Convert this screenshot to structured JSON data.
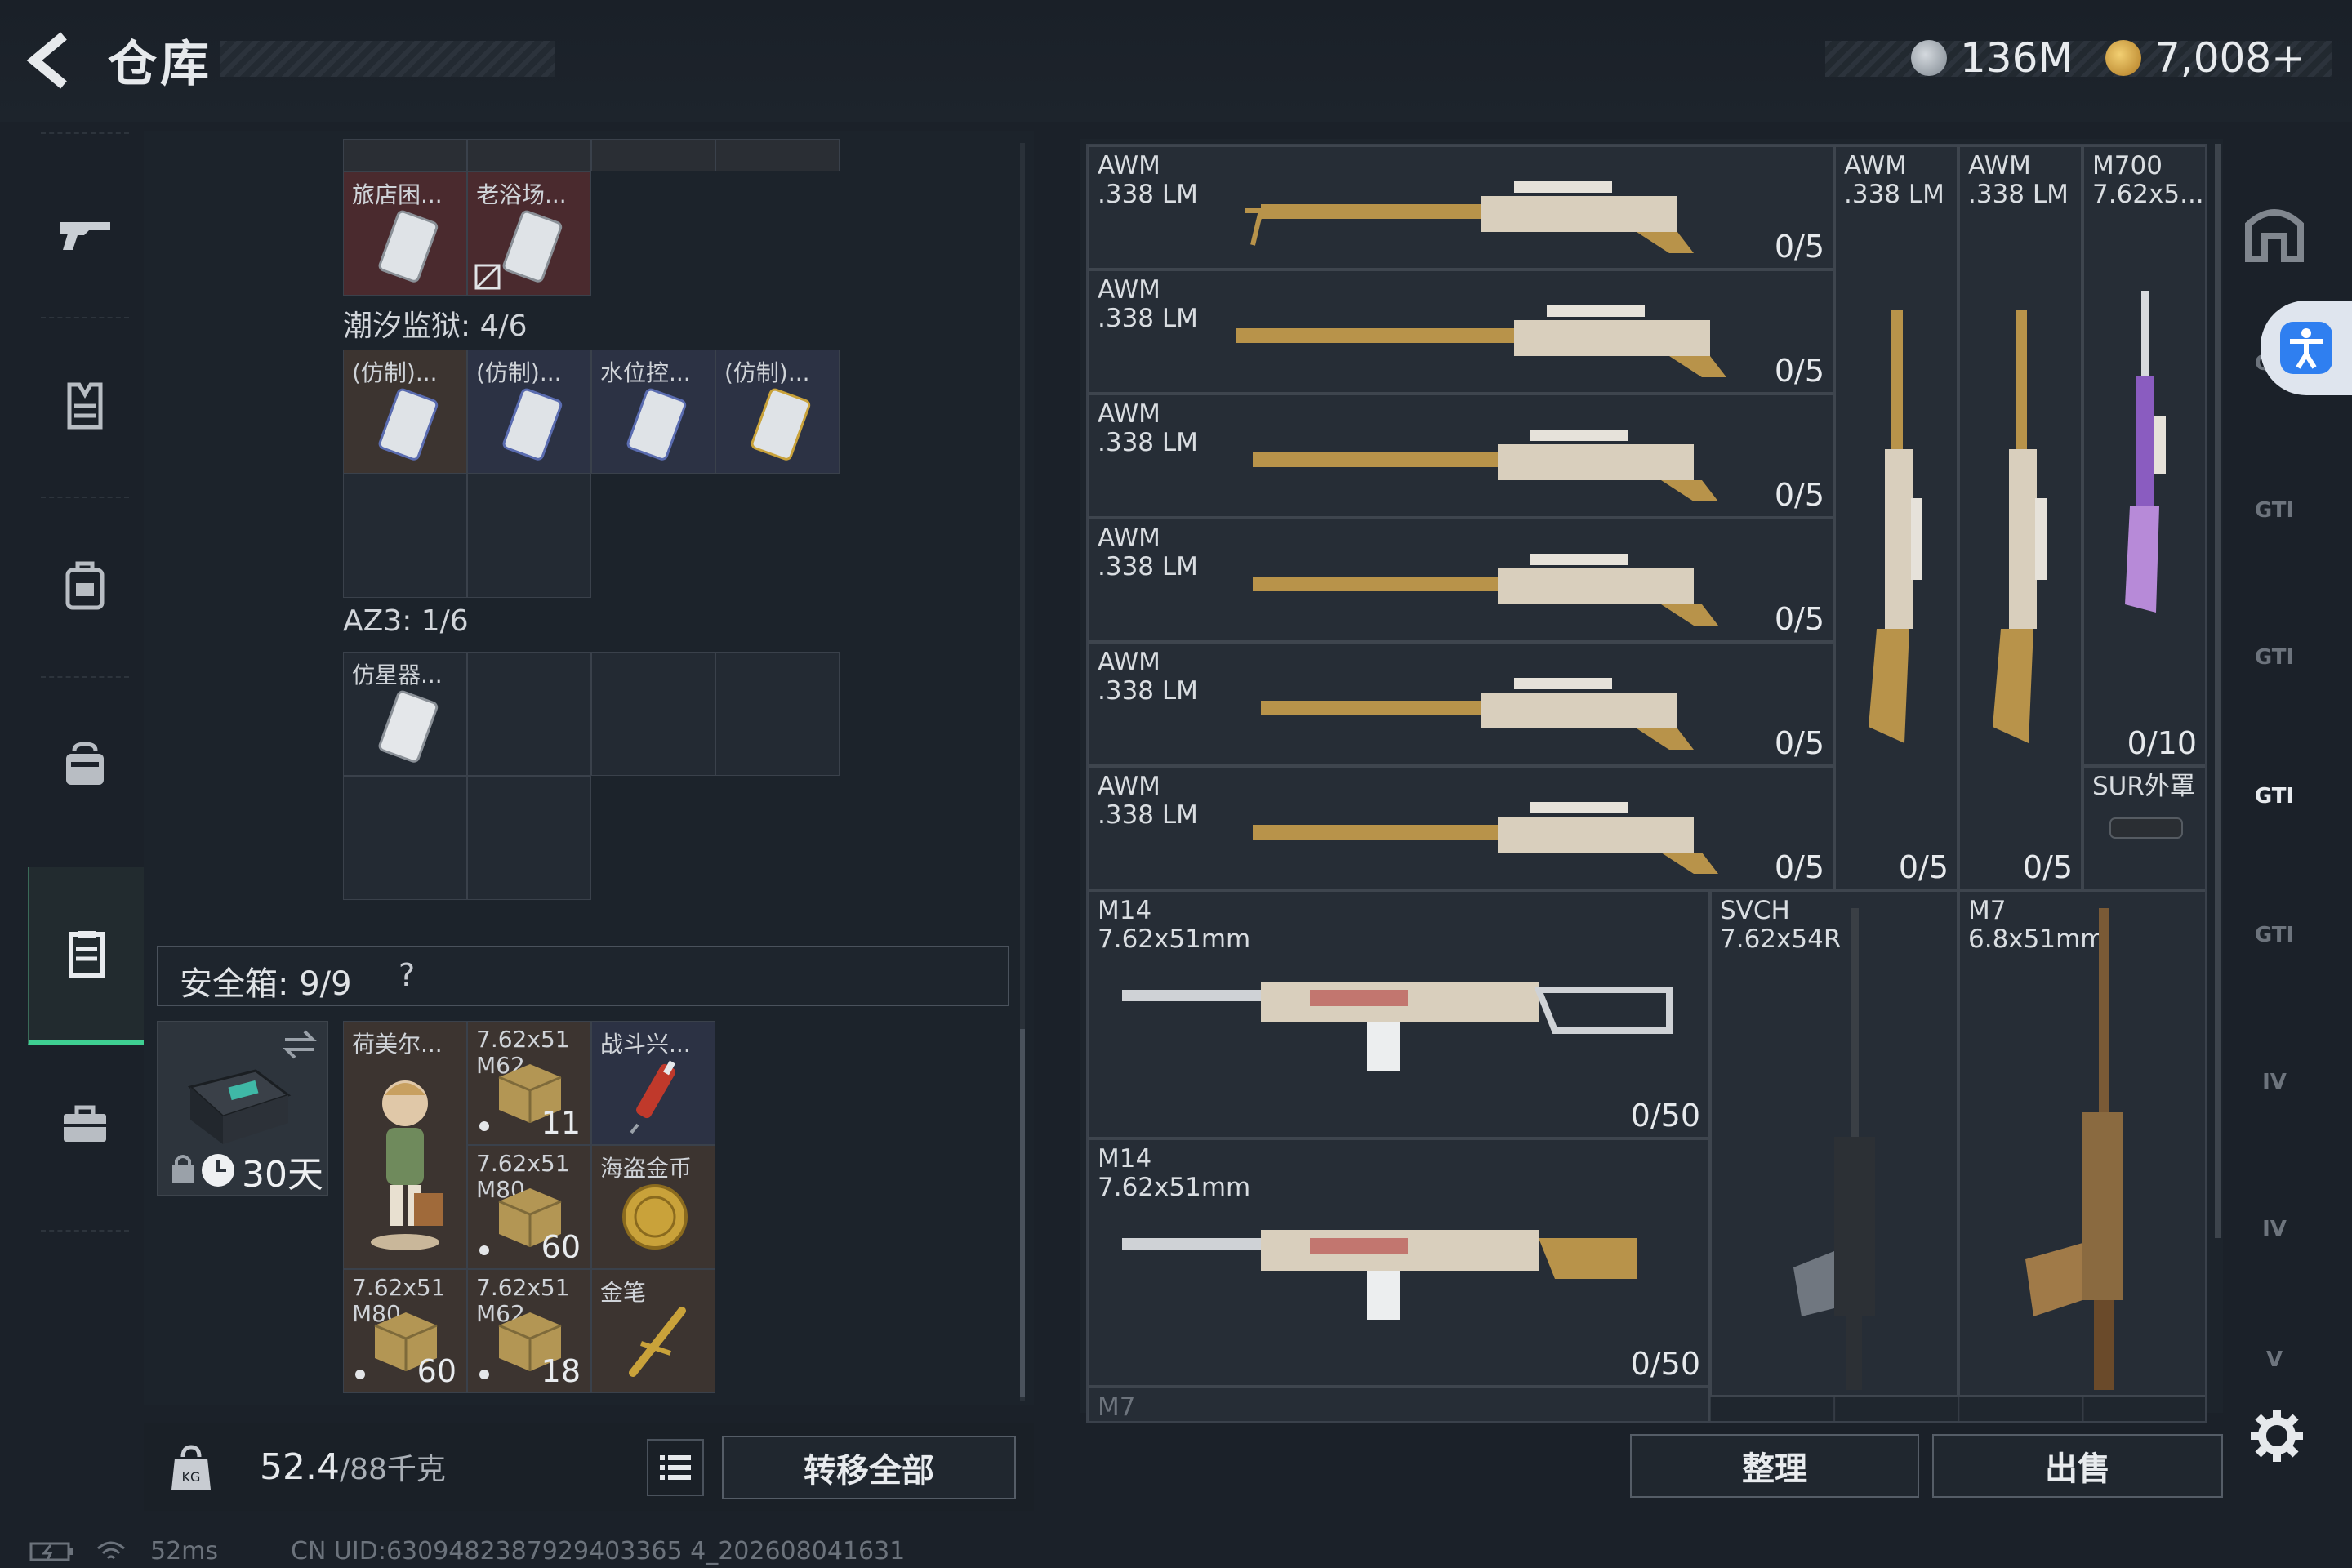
{
  "header": {
    "title": "仓库",
    "currencies": [
      {
        "icon": "silver-coin-icon",
        "value": "136M"
      },
      {
        "icon": "gold-coin-icon",
        "value": "7,008+"
      }
    ]
  },
  "nav": {
    "items": [
      {
        "icon": "weapon-icon"
      },
      {
        "icon": "armor-vest-icon"
      },
      {
        "icon": "backpack-icon"
      },
      {
        "icon": "chest-rig-icon"
      },
      {
        "icon": "container-icon",
        "active": true
      },
      {
        "icon": "briefcase-icon"
      }
    ]
  },
  "stash": {
    "top_items": [
      {
        "label": "旅店困...",
        "style": "red"
      },
      {
        "label": "老浴场...",
        "style": "red"
      }
    ],
    "sections": [
      {
        "label": "潮汐监狱: 4/6",
        "items": [
          {
            "label": "(仿制)..."
          },
          {
            "label": "(仿制)..."
          },
          {
            "label": "水位控..."
          },
          {
            "label": "(仿制)..."
          }
        ]
      },
      {
        "label": "AZ3: 1/6",
        "items": [
          {
            "label": "仿星器..."
          }
        ]
      }
    ]
  },
  "safe_box": {
    "label": "安全箱: 9/9",
    "help": "?",
    "days": "30天",
    "items": [
      {
        "label": "荷美尔...",
        "count": ""
      },
      {
        "label": "7.62x51\nM62",
        "count": "11"
      },
      {
        "label": "战斗兴...",
        "count": ""
      },
      {
        "label": "7.62x51\nM80",
        "count": "60"
      },
      {
        "label": "海盗金币",
        "count": ""
      },
      {
        "label": "7.62x51\nM80",
        "count": "60"
      },
      {
        "label": "7.62x51\nM62",
        "count": "18"
      },
      {
        "label": "金笔",
        "count": ""
      }
    ]
  },
  "footer": {
    "weight": "52.4",
    "weight_max": "/88千克",
    "transfer_all": "转移全部",
    "sort": "整理",
    "sell": "出售"
  },
  "weapons": [
    {
      "name": "AWM\n.338 LM",
      "count": "0/5"
    },
    {
      "name": "AWM\n.338 LM",
      "count": "0/5"
    },
    {
      "name": "AWM\n.338 LM",
      "count": "0/5"
    },
    {
      "name": "AWM\n.338 LM",
      "count": "0/5"
    },
    {
      "name": "AWM\n.338 LM",
      "count": "0/5"
    },
    {
      "name": "AWM\n.338 LM",
      "count": "0/5"
    },
    {
      "name": "AWM\n.338 LM",
      "count": "0/5"
    },
    {
      "name": "AWM\n.338 LM",
      "count": "0/5"
    },
    {
      "name": "M700\n7.62x5...",
      "count": "0/10"
    },
    {
      "name": "SUR外罩",
      "count": ""
    },
    {
      "name": "M14\n7.62x51mm",
      "count": "0/50"
    },
    {
      "name": "M14\n7.62x51mm",
      "count": "0/50"
    },
    {
      "name": "SVCH\n7.62x54R",
      "count": ""
    },
    {
      "name": "M7\n6.8x51mm",
      "count": ""
    },
    {
      "name": "M7",
      "count": ""
    }
  ],
  "right_tabs": [
    "GTI",
    "GTI",
    "GTI",
    "GTI",
    "GTI",
    "IV",
    "IV",
    "V"
  ],
  "status": {
    "ping": "52ms",
    "uid": "CN UID:6309482387929403365 4_202608041631"
  },
  "colors": {
    "accent_green": "#3fcf92",
    "background": "#1b2129",
    "silver_coin": "#9aa3ad",
    "gold_coin": "#d8a640"
  }
}
